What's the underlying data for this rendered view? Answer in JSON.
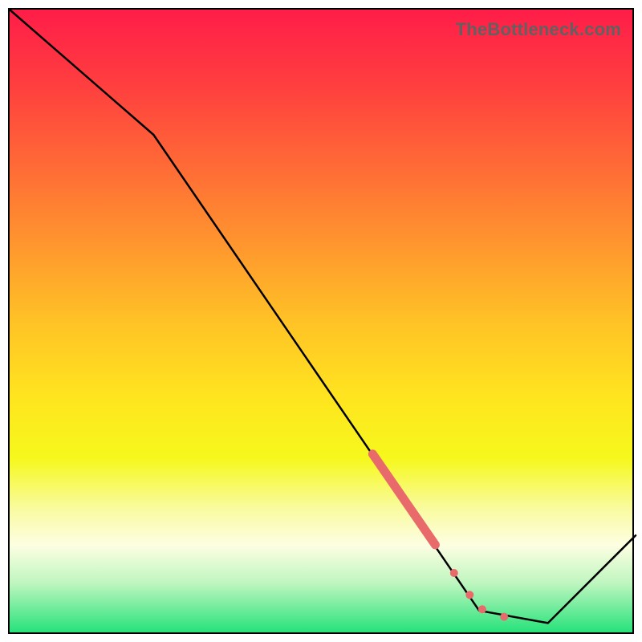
{
  "watermark": "TheBottleneck.com",
  "colors": {
    "curve_stroke": "#000000",
    "marker_fill": "#e96a6a",
    "marker_stroke": "#e96a6a"
  },
  "chart_data": {
    "type": "line",
    "title": "",
    "xlabel": "",
    "ylabel": "",
    "xlim": [
      0,
      100
    ],
    "ylim": [
      0,
      100
    ],
    "grid": false,
    "legend": false,
    "curve": [
      {
        "x": 0,
        "y": 100
      },
      {
        "x": 23,
        "y": 80
      },
      {
        "x": 75,
        "y": 4
      },
      {
        "x": 86,
        "y": 2
      },
      {
        "x": 100,
        "y": 16
      }
    ],
    "fat_segment": {
      "x0": 58,
      "y0": 29,
      "x1": 68,
      "y1": 14.5
    },
    "markers": [
      {
        "x": 71,
        "y": 10,
        "r": 4.5
      },
      {
        "x": 73.5,
        "y": 6.5,
        "r": 4.5
      },
      {
        "x": 75.5,
        "y": 4.2,
        "r": 4.5
      },
      {
        "x": 79,
        "y": 3,
        "r": 4.5
      }
    ]
  }
}
